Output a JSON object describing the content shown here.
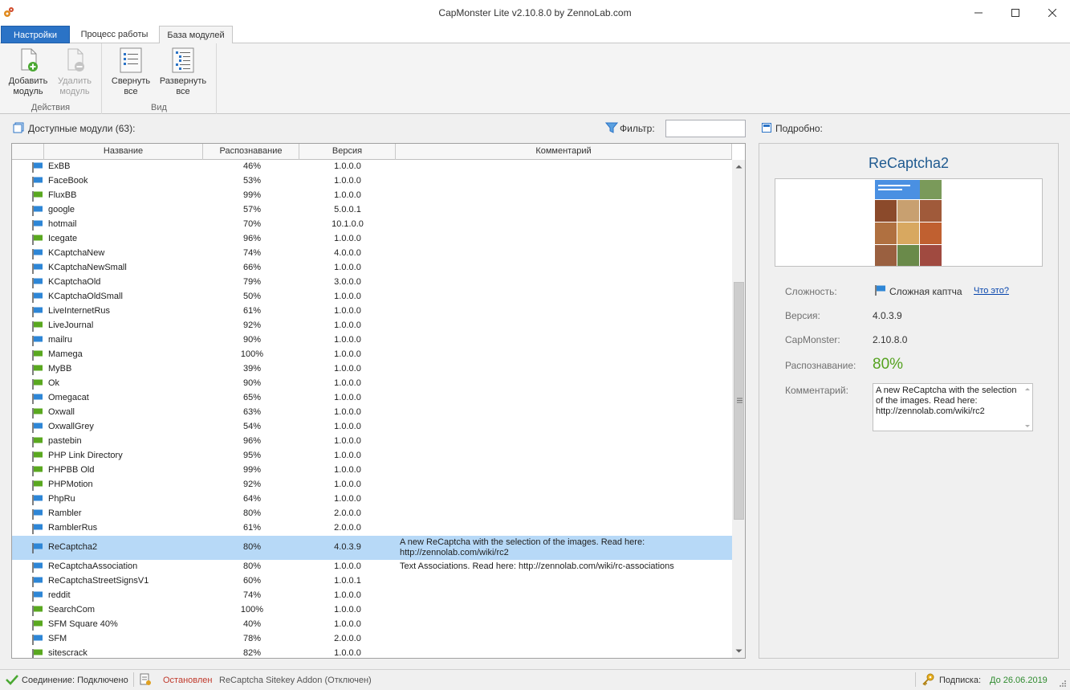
{
  "window": {
    "title": "CapMonster Lite v2.10.8.0 by ZennoLab.com"
  },
  "ribbon": {
    "tabs": [
      "Настройки",
      "Процесс работы",
      "База модулей"
    ],
    "active_tab": "База модулей",
    "groups": {
      "actions": {
        "label": "Действия",
        "add_module_line1": "Добавить",
        "add_module_line2": "модуль",
        "remove_module_line1": "Удалить",
        "remove_module_line2": "модуль"
      },
      "view": {
        "label": "Вид",
        "collapse_line1": "Свернуть",
        "collapse_line2": "все",
        "expand_line1": "Развернуть",
        "expand_line2": "все"
      }
    }
  },
  "modules_list": {
    "title": "Доступные модули (63):",
    "filter_label": "Фильтр:",
    "filter_value": "",
    "columns": [
      "Название",
      "Распознавание",
      "Версия",
      "Комментарий"
    ],
    "rows": [
      {
        "name": "ExBB",
        "rate": "46%",
        "version": "1.0.0.0",
        "comment": "",
        "flag": "blue"
      },
      {
        "name": "FaceBook",
        "rate": "53%",
        "version": "1.0.0.0",
        "comment": "",
        "flag": "blue"
      },
      {
        "name": "FluxBB",
        "rate": "99%",
        "version": "1.0.0.0",
        "comment": "",
        "flag": "green"
      },
      {
        "name": "google",
        "rate": "57%",
        "version": "5.0.0.1",
        "comment": "",
        "flag": "blue"
      },
      {
        "name": "hotmail",
        "rate": "70%",
        "version": "10.1.0.0",
        "comment": "",
        "flag": "blue"
      },
      {
        "name": "Icegate",
        "rate": "96%",
        "version": "1.0.0.0",
        "comment": "",
        "flag": "green"
      },
      {
        "name": "KCaptchaNew",
        "rate": "74%",
        "version": "4.0.0.0",
        "comment": "",
        "flag": "blue"
      },
      {
        "name": "KCaptchaNewSmall",
        "rate": "66%",
        "version": "1.0.0.0",
        "comment": "",
        "flag": "blue"
      },
      {
        "name": "KCaptchaOld",
        "rate": "79%",
        "version": "3.0.0.0",
        "comment": "",
        "flag": "blue"
      },
      {
        "name": "KCaptchaOldSmall",
        "rate": "50%",
        "version": "1.0.0.0",
        "comment": "",
        "flag": "blue"
      },
      {
        "name": "LiveInternetRus",
        "rate": "61%",
        "version": "1.0.0.0",
        "comment": "",
        "flag": "blue"
      },
      {
        "name": "LiveJournal",
        "rate": "92%",
        "version": "1.0.0.0",
        "comment": "",
        "flag": "green"
      },
      {
        "name": "mailru",
        "rate": "90%",
        "version": "1.0.0.0",
        "comment": "",
        "flag": "blue"
      },
      {
        "name": "Mamega",
        "rate": "100%",
        "version": "1.0.0.0",
        "comment": "",
        "flag": "green"
      },
      {
        "name": "MyBB",
        "rate": "39%",
        "version": "1.0.0.0",
        "comment": "",
        "flag": "green"
      },
      {
        "name": "Ok",
        "rate": "90%",
        "version": "1.0.0.0",
        "comment": "",
        "flag": "green"
      },
      {
        "name": "Omegacat",
        "rate": "65%",
        "version": "1.0.0.0",
        "comment": "",
        "flag": "blue"
      },
      {
        "name": "Oxwall",
        "rate": "63%",
        "version": "1.0.0.0",
        "comment": "",
        "flag": "green"
      },
      {
        "name": "OxwallGrey",
        "rate": "54%",
        "version": "1.0.0.0",
        "comment": "",
        "flag": "blue"
      },
      {
        "name": "pastebin",
        "rate": "96%",
        "version": "1.0.0.0",
        "comment": "",
        "flag": "green"
      },
      {
        "name": "PHP Link Directory",
        "rate": "95%",
        "version": "1.0.0.0",
        "comment": "",
        "flag": "green"
      },
      {
        "name": "PHPBB Old",
        "rate": "99%",
        "version": "1.0.0.0",
        "comment": "",
        "flag": "green"
      },
      {
        "name": "PHPMotion",
        "rate": "92%",
        "version": "1.0.0.0",
        "comment": "",
        "flag": "green"
      },
      {
        "name": "PhpRu",
        "rate": "64%",
        "version": "1.0.0.0",
        "comment": "",
        "flag": "blue"
      },
      {
        "name": "Rambler",
        "rate": "80%",
        "version": "2.0.0.0",
        "comment": "",
        "flag": "blue"
      },
      {
        "name": "RamblerRus",
        "rate": "61%",
        "version": "2.0.0.0",
        "comment": "",
        "flag": "blue"
      },
      {
        "name": "ReCaptcha2",
        "rate": "80%",
        "version": "4.0.3.9",
        "comment": "A new ReCaptcha with the selection of the images. Read here: http://zennolab.com/wiki/rc2",
        "flag": "blue",
        "selected": true
      },
      {
        "name": "ReCaptchaAssociation",
        "rate": "80%",
        "version": "1.0.0.0",
        "comment": "Text Associations. Read here: http://zennolab.com/wiki/rc-associations",
        "flag": "blue"
      },
      {
        "name": "ReCaptchaStreetSignsV1",
        "rate": "60%",
        "version": "1.0.0.1",
        "comment": "",
        "flag": "blue"
      },
      {
        "name": "reddit",
        "rate": "74%",
        "version": "1.0.0.0",
        "comment": "",
        "flag": "blue"
      },
      {
        "name": "SearchCom",
        "rate": "100%",
        "version": "1.0.0.0",
        "comment": "",
        "flag": "green"
      },
      {
        "name": "SFM Square 40%",
        "rate": "40%",
        "version": "1.0.0.0",
        "comment": "",
        "flag": "green"
      },
      {
        "name": "SFM",
        "rate": "78%",
        "version": "2.0.0.0",
        "comment": "",
        "flag": "blue"
      },
      {
        "name": "sitescrack",
        "rate": "82%",
        "version": "1.0.0.0",
        "comment": "",
        "flag": "green"
      }
    ]
  },
  "details": {
    "header": "Подробно:",
    "title": "ReCaptcha2",
    "complexity_label": "Сложность:",
    "complexity_value": "Сложная каптча",
    "what_is_link": "Что это?",
    "version_label": "Версия:",
    "version_value": "4.0.3.9",
    "capmonster_label": "CapMonster:",
    "capmonster_value": "2.10.8.0",
    "recognition_label": "Распознавание:",
    "recognition_value": "80%",
    "comment_label": "Комментарий:",
    "comment_value": "A new ReCaptcha with the selection of the images. Read here: http://zennolab.com/wiki/rc2"
  },
  "statusbar": {
    "connection": "Соединение: Подключено",
    "process_state": "Остановлен",
    "addon": "ReCaptcha Sitekey Addon (Отключен)",
    "subscription_label": "Подписка:",
    "subscription_value": "До 26.06.2019"
  },
  "colors": {
    "accent_blue": "#2b73c6",
    "selected_row": "#b7d9f7",
    "rate_green": "#54a21f",
    "stopped_red": "#c0392b",
    "flag_blue": "#2e86d6",
    "flag_green": "#5aa820"
  },
  "icons": {
    "app": "gear-app-icon",
    "add": "add-module-icon",
    "remove": "remove-module-icon",
    "collapse": "collapse-all-icon",
    "expand": "expand-all-icon",
    "filter": "funnel-icon",
    "flag": "flag-icon",
    "key": "key-icon",
    "check": "check-icon"
  }
}
